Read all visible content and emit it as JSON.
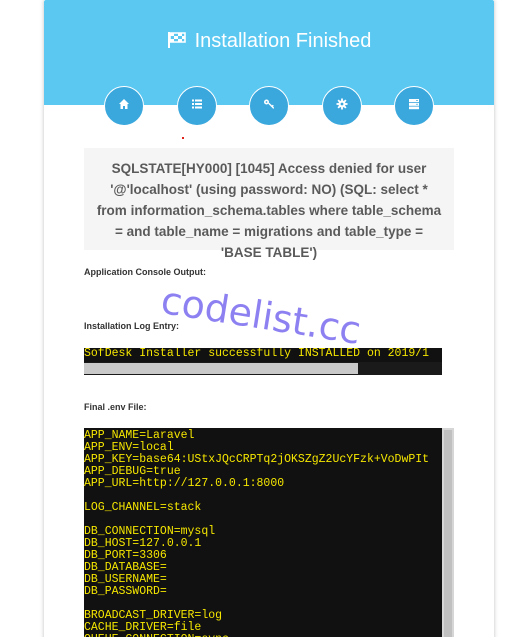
{
  "header": {
    "title": "Installation Finished",
    "background_color": "#5bc8f1",
    "step_color": "#3aa7dd",
    "steps": [
      {
        "icon": "home-icon"
      },
      {
        "icon": "list-icon"
      },
      {
        "icon": "key-icon"
      },
      {
        "icon": "gear-icon"
      },
      {
        "icon": "server-icon"
      }
    ]
  },
  "error": {
    "message": "SQLSTATE[HY000] [1045] Access denied for user '@'localhost' (using password: NO) (SQL: select * from information_schema.tables where table_schema = and table_name = migrations and table_type = 'BASE TABLE')"
  },
  "console": {
    "label": "Application Console Output:"
  },
  "log": {
    "label": "Installation Log Entry:",
    "text": "SofDesk Installer successfully INSTALLED on 2019/1"
  },
  "env": {
    "label": "Final .env File:",
    "text": "APP_NAME=Laravel\nAPP_ENV=local\nAPP_KEY=base64:UStxJQcCRPTq2jOKSZgZ2UcYFzk+VoDwPIt\nAPP_DEBUG=true\nAPP_URL=http://127.0.0.1:8000\n\nLOG_CHANNEL=stack\n\nDB_CONNECTION=mysql\nDB_HOST=127.0.0.1\nDB_PORT=3306\nDB_DATABASE=\nDB_USERNAME=\nDB_PASSWORD=\n\nBROADCAST_DRIVER=log\nCACHE_DRIVER=file\nQUEUE_CONNECTION=sync"
  },
  "watermark": "codelist.cc"
}
